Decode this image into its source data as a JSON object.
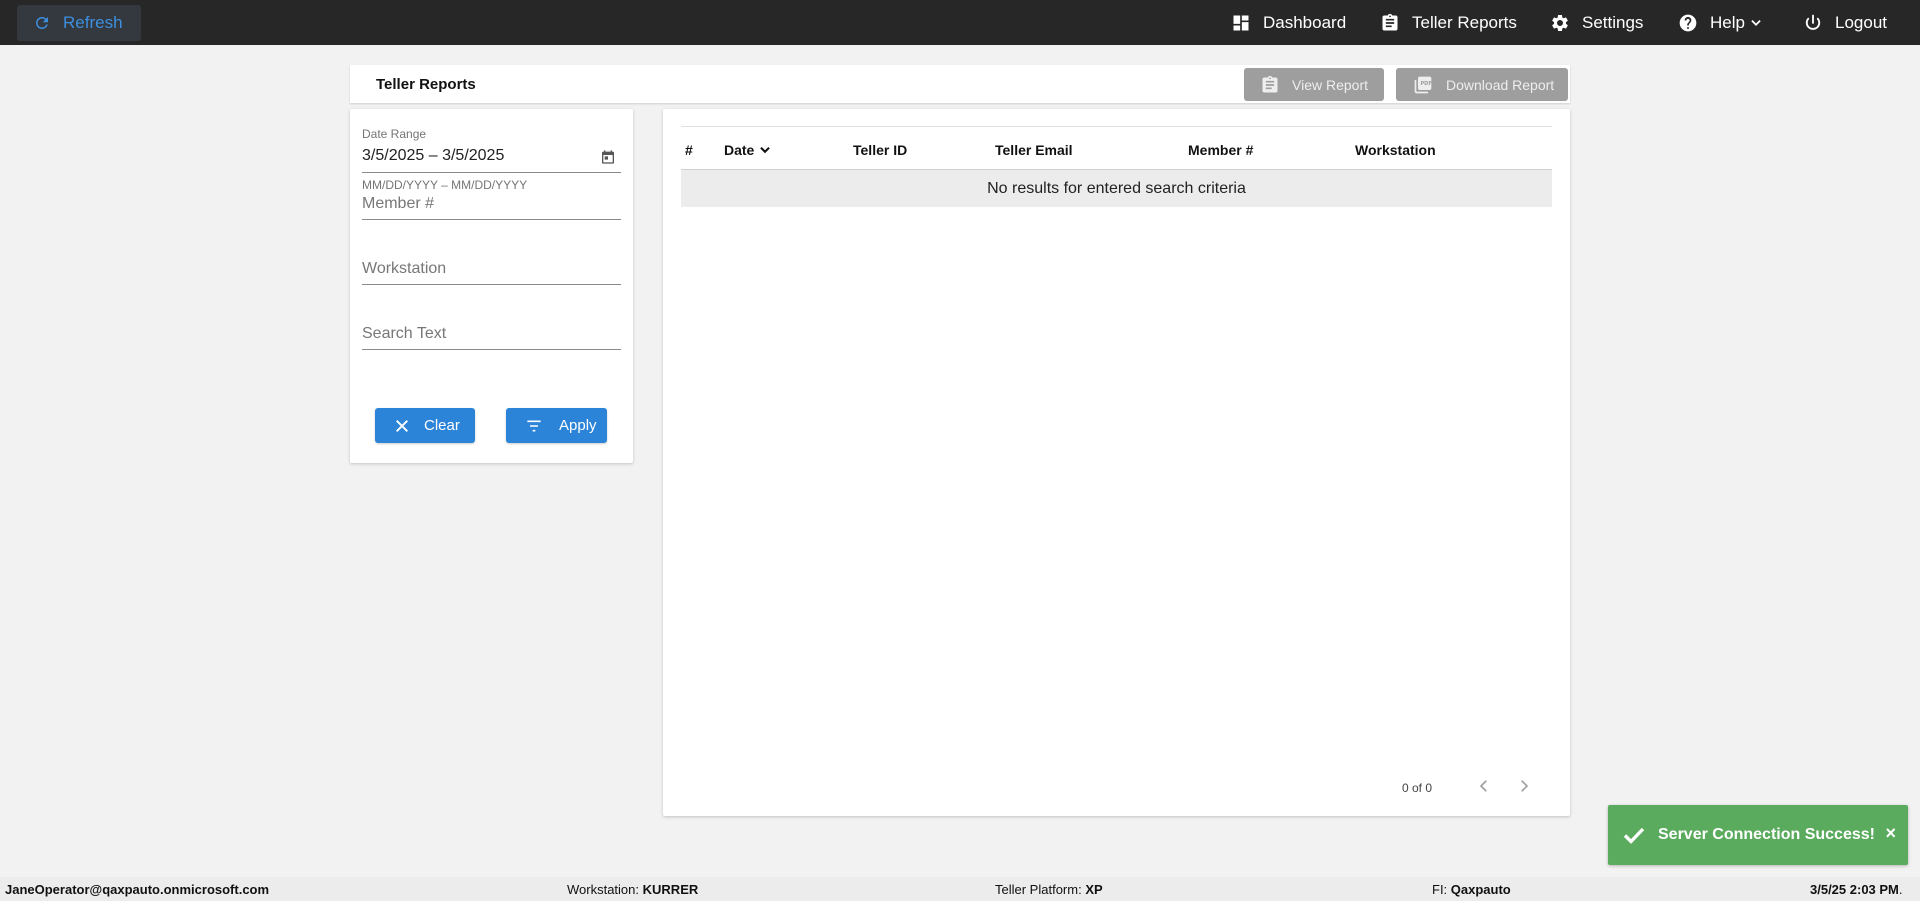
{
  "topbar": {
    "refresh_label": "Refresh",
    "nav": {
      "dashboard": "Dashboard",
      "teller_reports": "Teller Reports",
      "settings": "Settings",
      "help": "Help",
      "logout": "Logout"
    }
  },
  "header": {
    "title": "Teller Reports",
    "view_report": "View Report",
    "download_report": "Download Report"
  },
  "filters": {
    "date_range_label": "Date Range",
    "date_range_value": "3/5/2025 – 3/5/2025",
    "date_range_hint": "MM/DD/YYYY – MM/DD/YYYY",
    "member_placeholder": "Member #",
    "workstation_placeholder": "Workstation",
    "search_placeholder": "Search Text",
    "clear_label": "Clear",
    "apply_label": "Apply"
  },
  "table": {
    "columns": [
      "#",
      "Date",
      "Teller ID",
      "Teller Email",
      "Member #",
      "Workstation"
    ],
    "empty_message": "No results for entered search criteria",
    "pager_text": "0 of 0"
  },
  "toast": {
    "message": "Server Connection Success!",
    "close": "×"
  },
  "statusbar": {
    "user": "JaneOperator@qaxpauto.onmicrosoft.com",
    "workstation_label": "Workstation:",
    "workstation_value": "KURRER",
    "platform_label": "Teller Platform:",
    "platform_value": "XP",
    "fi_label": "FI:",
    "fi_value": "Qaxpauto",
    "datetime": "3/5/25 2:03 PM",
    "datetime_suffix": "."
  },
  "colors": {
    "topbar": "#272727",
    "accent_blue": "#2b84d8",
    "refresh_text": "#3d8fe0",
    "disabled_button": "#9e9e9e",
    "toast_green": "#5aab5e"
  },
  "icons": [
    "refresh-icon",
    "dashboard-icon",
    "clipboard-icon",
    "gear-icon",
    "help-icon",
    "chevron-down-icon",
    "power-icon",
    "calendar-icon",
    "close-icon",
    "filter-icon",
    "pdf-icon",
    "chevron-left-icon",
    "chevron-right-icon",
    "check-icon"
  ]
}
